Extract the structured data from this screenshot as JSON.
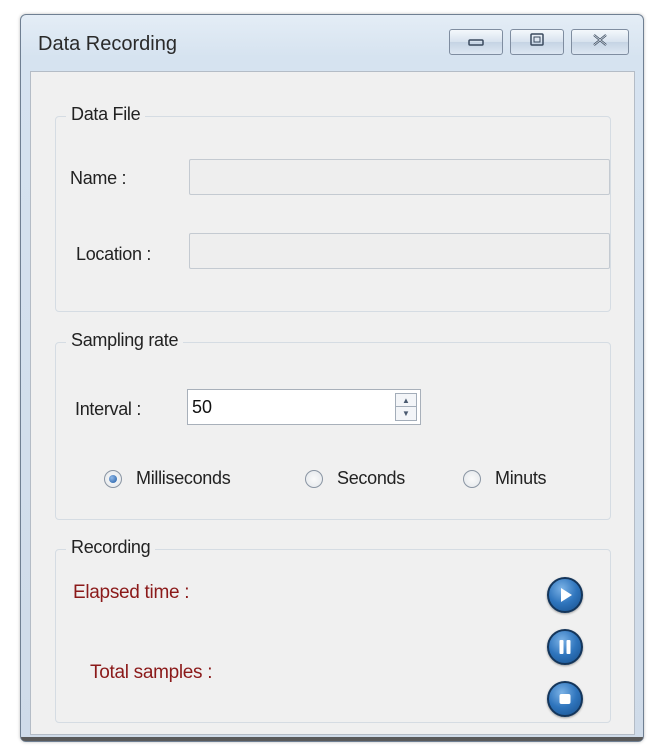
{
  "window": {
    "title": "Data Recording"
  },
  "data_file": {
    "legend": "Data File",
    "name_label": "Name :",
    "name_value": "",
    "location_label": "Location :",
    "location_value": ""
  },
  "sampling": {
    "legend": "Sampling rate",
    "interval_label": "Interval :",
    "interval_value": "50",
    "units": [
      {
        "label": "Milliseconds",
        "selected": true
      },
      {
        "label": "Seconds",
        "selected": false
      },
      {
        "label": "Minuts",
        "selected": false
      }
    ]
  },
  "recording": {
    "legend": "Recording",
    "elapsed_label": "Elapsed time :",
    "samples_label": "Total samples :",
    "buttons": [
      "play-icon",
      "pause-icon",
      "stop-icon"
    ]
  },
  "colors": {
    "accent_red": "#8b1a1a",
    "button_blue": "#2f75bd"
  }
}
